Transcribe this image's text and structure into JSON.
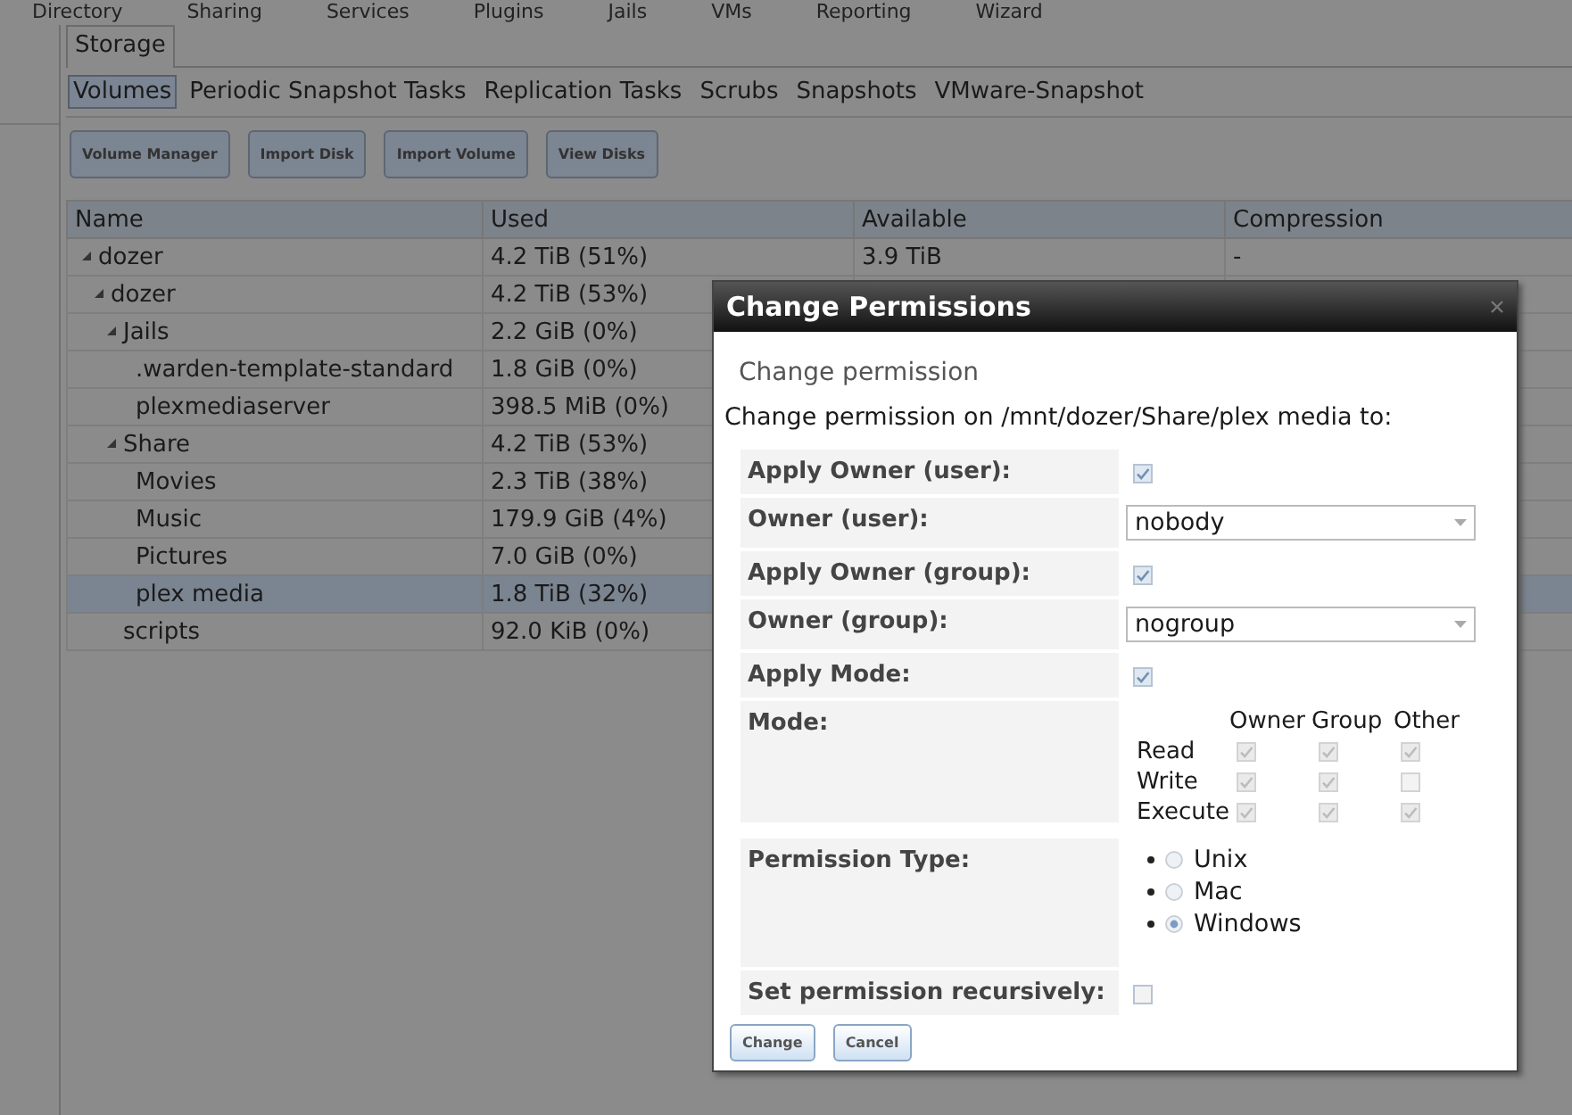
{
  "menu": [
    "Directory",
    "Sharing",
    "Services",
    "Plugins",
    "Jails",
    "VMs",
    "Reporting",
    "Wizard"
  ],
  "main_tab": "Storage",
  "subtabs": [
    {
      "label": "Volumes",
      "selected": true
    },
    {
      "label": "Periodic Snapshot Tasks",
      "selected": false
    },
    {
      "label": "Replication Tasks",
      "selected": false
    },
    {
      "label": "Scrubs",
      "selected": false
    },
    {
      "label": "Snapshots",
      "selected": false
    },
    {
      "label": "VMware-Snapshot",
      "selected": false
    }
  ],
  "buttons": [
    "Volume Manager",
    "Import Disk",
    "Import Volume",
    "View Disks"
  ],
  "table": {
    "columns": [
      "Name",
      "Used",
      "Available",
      "Compression"
    ],
    "rows": [
      {
        "name": "dozer",
        "used": "4.2 TiB (51%)",
        "available": "3.9 TiB",
        "compression": "-",
        "selected": false,
        "expanded": true,
        "children": [
          {
            "name": "dozer",
            "used": "4.2 TiB (53%)",
            "selected": false,
            "expanded": true,
            "children": [
              {
                "name": "Jails",
                "used": "2.2 GiB (0%)",
                "selected": false,
                "expanded": true,
                "children": [
                  {
                    "name": ".warden-template-standard",
                    "used": "1.8 GiB (0%)",
                    "selected": false
                  },
                  {
                    "name": "plexmediaserver",
                    "used": "398.5 MiB (0%)",
                    "selected": false
                  }
                ]
              },
              {
                "name": "Share",
                "used": "4.2 TiB (53%)",
                "selected": false,
                "expanded": true,
                "children": [
                  {
                    "name": "Movies",
                    "used": "2.3 TiB (38%)",
                    "selected": false
                  },
                  {
                    "name": "Music",
                    "used": "179.9 GiB (4%)",
                    "selected": false
                  },
                  {
                    "name": "Pictures",
                    "used": "7.0 GiB (0%)",
                    "selected": false
                  },
                  {
                    "name": "plex media",
                    "used": "1.8 TiB (32%)",
                    "selected": true
                  }
                ]
              },
              {
                "name": "scripts",
                "used": "92.0 KiB (0%)",
                "selected": false
              }
            ]
          }
        ]
      }
    ]
  },
  "dialog": {
    "title": "Change Permissions",
    "subtitle": "Change permission",
    "description": "Change permission on /mnt/dozer/Share/plex media to:",
    "fields": [
      {
        "kind": "checkbox",
        "label": "Apply Owner (user):",
        "checked": true
      },
      {
        "kind": "select",
        "label": "Owner (user):",
        "value": "nobody"
      },
      {
        "kind": "checkbox",
        "label": "Apply Owner (group):",
        "checked": true
      },
      {
        "kind": "select",
        "label": "Owner (group):",
        "value": "nogroup"
      },
      {
        "kind": "checkbox",
        "label": "Apply Mode:",
        "checked": true
      },
      {
        "kind": "mode",
        "label": "Mode:",
        "columns": [
          "Owner",
          "Group",
          "Other"
        ],
        "rows": [
          {
            "label": "Read",
            "checks": [
              {
                "checked": true
              },
              {
                "checked": true
              },
              {
                "checked": true
              }
            ]
          },
          {
            "label": "Write",
            "checks": [
              {
                "checked": true
              },
              {
                "checked": true
              },
              {
                "checked": false
              }
            ]
          },
          {
            "label": "Execute",
            "checks": [
              {
                "checked": true
              },
              {
                "checked": true
              },
              {
                "checked": true
              }
            ]
          }
        ]
      },
      {
        "kind": "radio",
        "label": "Permission Type:",
        "options": [
          {
            "label": "Unix",
            "selected": false
          },
          {
            "label": "Mac",
            "selected": false
          },
          {
            "label": "Windows",
            "selected": true
          }
        ]
      },
      {
        "kind": "checkbox",
        "label": "Set permission recursively:",
        "checked": false
      }
    ],
    "buttons": [
      "Change",
      "Cancel"
    ]
  }
}
